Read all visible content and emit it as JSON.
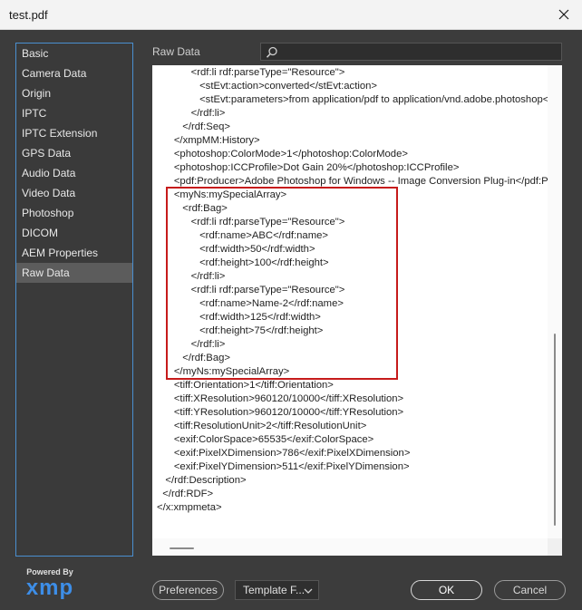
{
  "window": {
    "title": "test.pdf"
  },
  "sidebar": {
    "items": [
      {
        "label": "Basic"
      },
      {
        "label": "Camera Data"
      },
      {
        "label": "Origin"
      },
      {
        "label": "IPTC"
      },
      {
        "label": "IPTC Extension"
      },
      {
        "label": "GPS Data"
      },
      {
        "label": "Audio Data"
      },
      {
        "label": "Video Data"
      },
      {
        "label": "Photoshop"
      },
      {
        "label": "DICOM"
      },
      {
        "label": "AEM Properties"
      },
      {
        "label": "Raw Data"
      }
    ],
    "selected": "Raw Data"
  },
  "logo": {
    "powered_by": "Powered By",
    "brand": "xmp"
  },
  "panel": {
    "title": "Raw Data",
    "search_placeholder": ""
  },
  "raw_lines": [
    "            <rdf:li rdf:parseType=\"Resource\">",
    "               <stEvt:action>converted</stEvt:action>",
    "               <stEvt:parameters>from application/pdf to application/vnd.adobe.photoshop</stEvt:parameters>",
    "            </rdf:li>",
    "         </rdf:Seq>",
    "      </xmpMM:History>",
    "      <photoshop:ColorMode>1</photoshop:ColorMode>",
    "      <photoshop:ICCProfile>Dot Gain 20%</photoshop:ICCProfile>",
    "      <pdf:Producer>Adobe Photoshop for Windows -- Image Conversion Plug-in</pdf:Producer>",
    "      <myNs:mySpecialArray>",
    "         <rdf:Bag>",
    "            <rdf:li rdf:parseType=\"Resource\">",
    "               <rdf:name>ABC</rdf:name>",
    "               <rdf:width>50</rdf:width>",
    "               <rdf:height>100</rdf:height>",
    "            </rdf:li>",
    "            <rdf:li rdf:parseType=\"Resource\">",
    "               <rdf:name>Name-2</rdf:name>",
    "               <rdf:width>125</rdf:width>",
    "               <rdf:height>75</rdf:height>",
    "            </rdf:li>",
    "         </rdf:Bag>",
    "      </myNs:mySpecialArray>",
    "      <tiff:Orientation>1</tiff:Orientation>",
    "      <tiff:XResolution>960120/10000</tiff:XResolution>",
    "      <tiff:YResolution>960120/10000</tiff:YResolution>",
    "      <tiff:ResolutionUnit>2</tiff:ResolutionUnit>",
    "      <exif:ColorSpace>65535</exif:ColorSpace>",
    "      <exif:PixelXDimension>786</exif:PixelXDimension>",
    "      <exif:PixelYDimension>511</exif:PixelYDimension>",
    "   </rdf:Description>",
    "  </rdf:RDF>",
    "</x:xmpmeta>"
  ],
  "footer": {
    "preferences_label": "Preferences",
    "template_label": "Template F...",
    "ok_label": "OK",
    "cancel_label": "Cancel"
  },
  "colors": {
    "highlight": "#c61b1b",
    "sidebar_border": "#4a8fd0",
    "logo": "#3d8ee8"
  }
}
